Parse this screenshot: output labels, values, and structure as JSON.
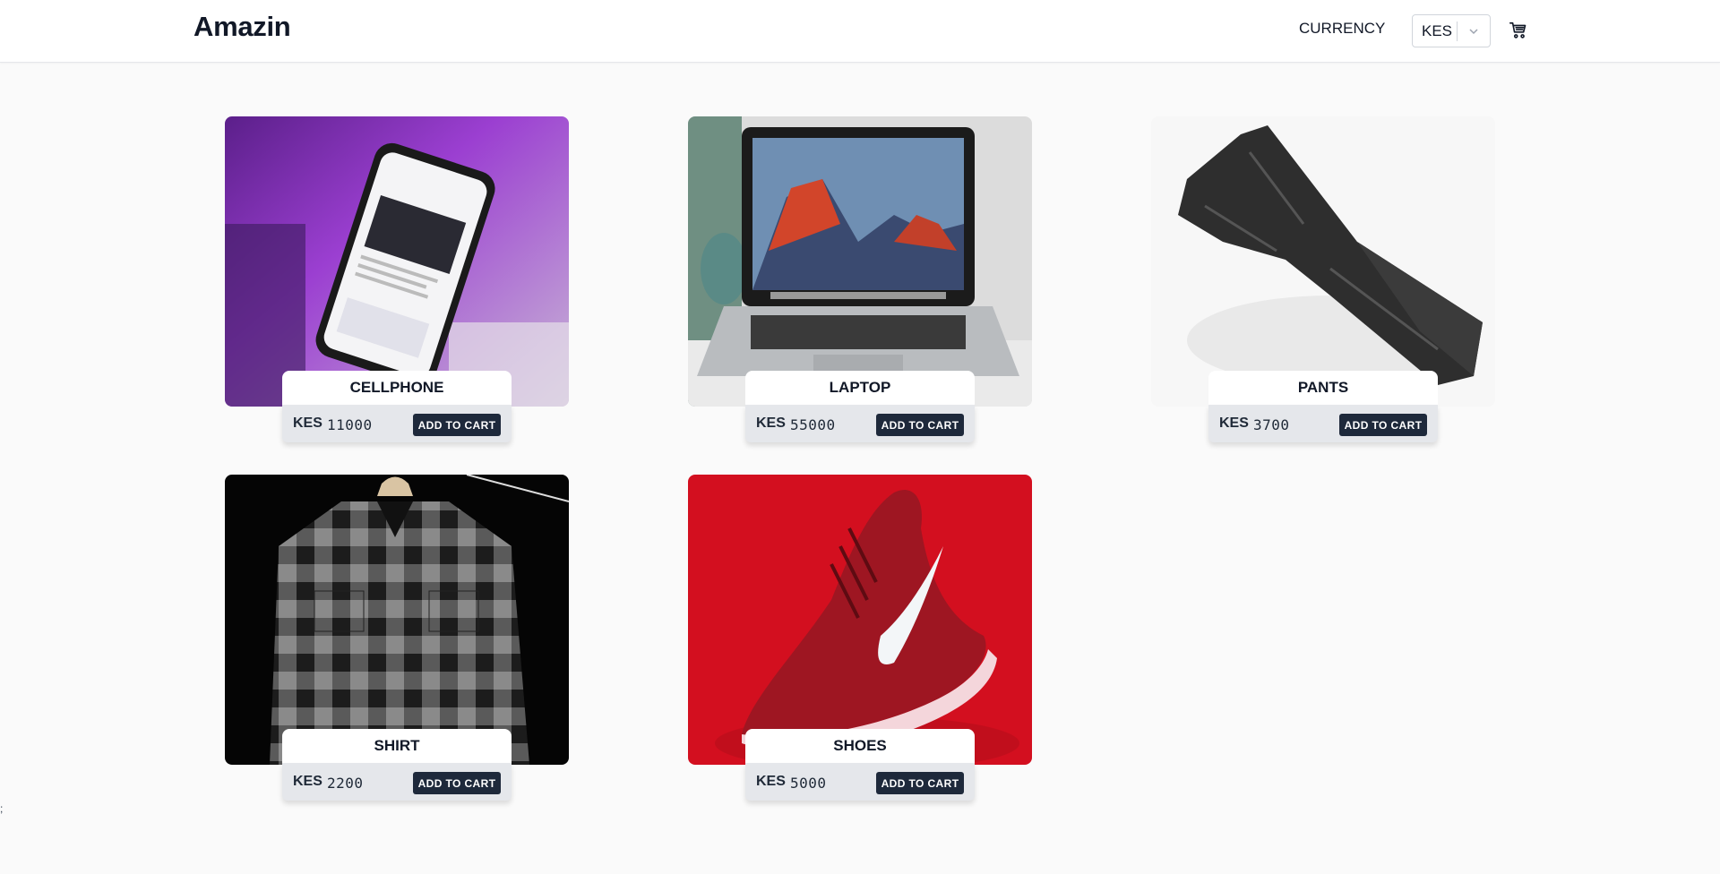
{
  "header": {
    "logo": "Amazin",
    "currency_label": "CURRENCY",
    "currency_selected": "KES",
    "cart_icon": "cart-icon"
  },
  "products": [
    {
      "name": "CELLPHONE",
      "currency": "KES",
      "price": "11000",
      "button": "ADD TO CART"
    },
    {
      "name": "LAPTOP",
      "currency": "KES",
      "price": "55000",
      "button": "ADD TO CART"
    },
    {
      "name": "PANTS",
      "currency": "KES",
      "price": "3700",
      "button": "ADD TO CART"
    },
    {
      "name": "SHIRT",
      "currency": "KES",
      "price": "2200",
      "button": "ADD TO CART"
    },
    {
      "name": "SHOES",
      "currency": "KES",
      "price": "5000",
      "button": "ADD TO CART"
    }
  ],
  "stray_text": ";",
  "colors": {
    "button_bg": "#1e293b",
    "price_bar_bg": "#e5e7eb",
    "page_bg": "#fafafa"
  }
}
